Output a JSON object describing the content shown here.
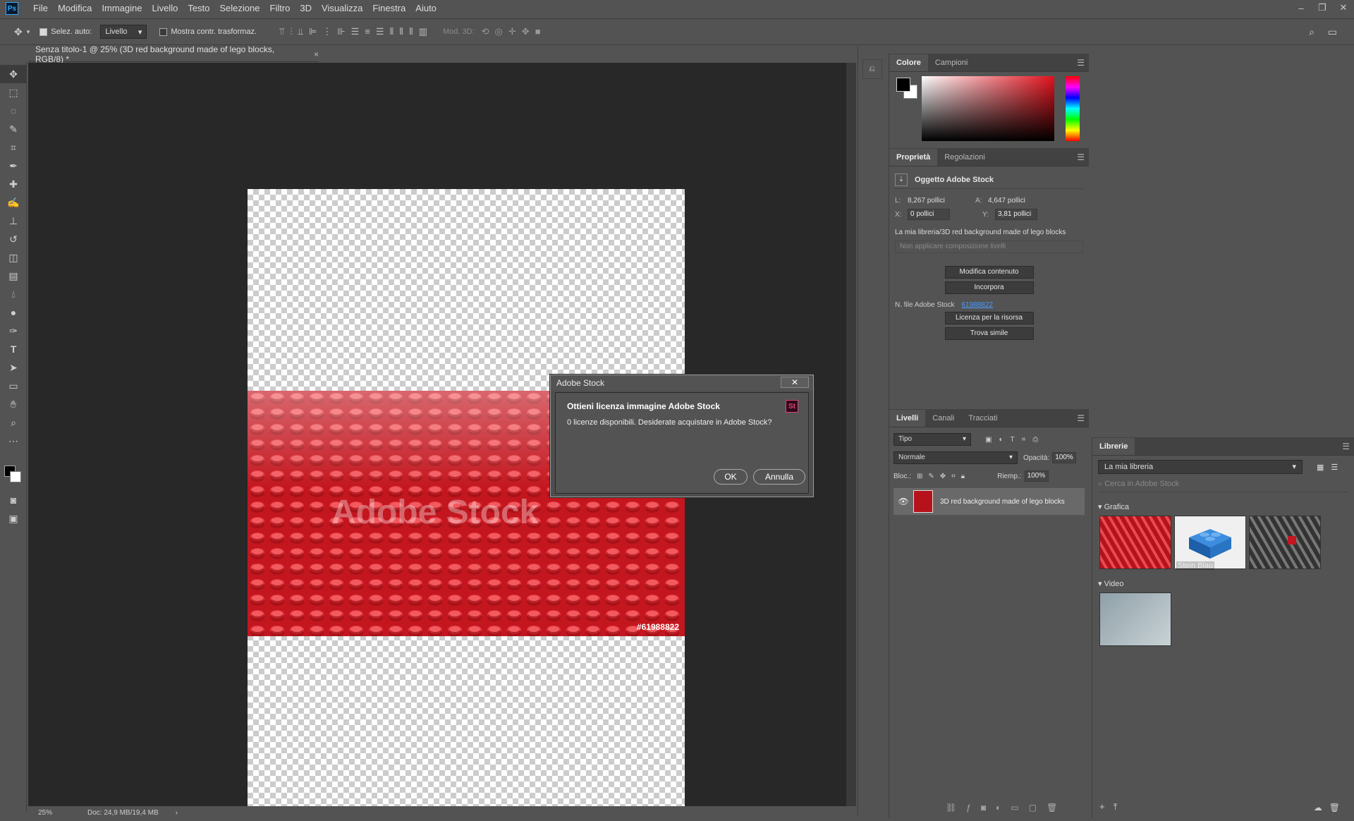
{
  "app": {
    "logo": "Ps"
  },
  "menu": [
    "File",
    "Modifica",
    "Immagine",
    "Livello",
    "Testo",
    "Selezione",
    "Filtro",
    "3D",
    "Visualizza",
    "Finestra",
    "Aiuto"
  ],
  "window_controls": [
    "–",
    "❐",
    "✕"
  ],
  "options": {
    "auto_select_label": "Selez. auto:",
    "auto_select_value": "Livello",
    "transform_label": "Mostra contr. trasformaz.",
    "mode3d_label": "Mod. 3D:"
  },
  "document": {
    "tab_title": "Senza titolo-1 @ 25% (3D red background made of lego blocks, RGB/8) *",
    "close": "×",
    "watermark": "Adobe Stock",
    "stock_overlay_id": "#61988822"
  },
  "status": {
    "zoom": "25%",
    "doc_size": "Doc: 24,9 MB/19,4 MB",
    "arrow": "›"
  },
  "color_panel": {
    "tabs": [
      "Colore",
      "Campioni"
    ]
  },
  "properties": {
    "tabs": [
      "Proprietà",
      "Regolazioni"
    ],
    "object_title": "Oggetto Adobe Stock",
    "L_label": "L:",
    "L_value": "8,267 pollici",
    "A_label": "A:",
    "A_value": "4,647 pollici",
    "X_label": "X:",
    "X_value": "0 pollici",
    "Y_label": "Y:",
    "Y_value": "3,81 pollici",
    "library_path": "La mia libreria/3D red background made of lego blocks",
    "layer_comp": "Non applicare composizione livelli",
    "btn_edit": "Modifica contenuto",
    "btn_embed": "Incorpora",
    "stock_file_label": "N. file Adobe Stock",
    "stock_file_id": "61988822",
    "btn_license": "Licenza per la risorsa",
    "btn_similar": "Trova simile"
  },
  "layers": {
    "tabs": [
      "Livelli",
      "Canali",
      "Tracciati"
    ],
    "filter": "Tipo",
    "blend": "Normale",
    "opacity_label": "Opacità:",
    "opacity": "100%",
    "lock_label": "Bloc.:",
    "fill_label": "Riemp.:",
    "fill": "100%",
    "layer_name": "3D red background made of lego blocks"
  },
  "libraries": {
    "title": "Librerie",
    "library": "La mia libreria",
    "search_placeholder": "Cerca in Adobe Stock",
    "section_graphics": "Grafica",
    "tile2_caption": "Stein Blau",
    "section_video": "Video"
  },
  "dialog": {
    "title": "Adobe Stock",
    "close": "✕",
    "heading": "Ottieni licenza immagine Adobe Stock",
    "logo": "St",
    "message": "0 licenze disponibili. Desiderate acquistare in Adobe Stock?",
    "ok": "OK",
    "cancel": "Annulla"
  }
}
